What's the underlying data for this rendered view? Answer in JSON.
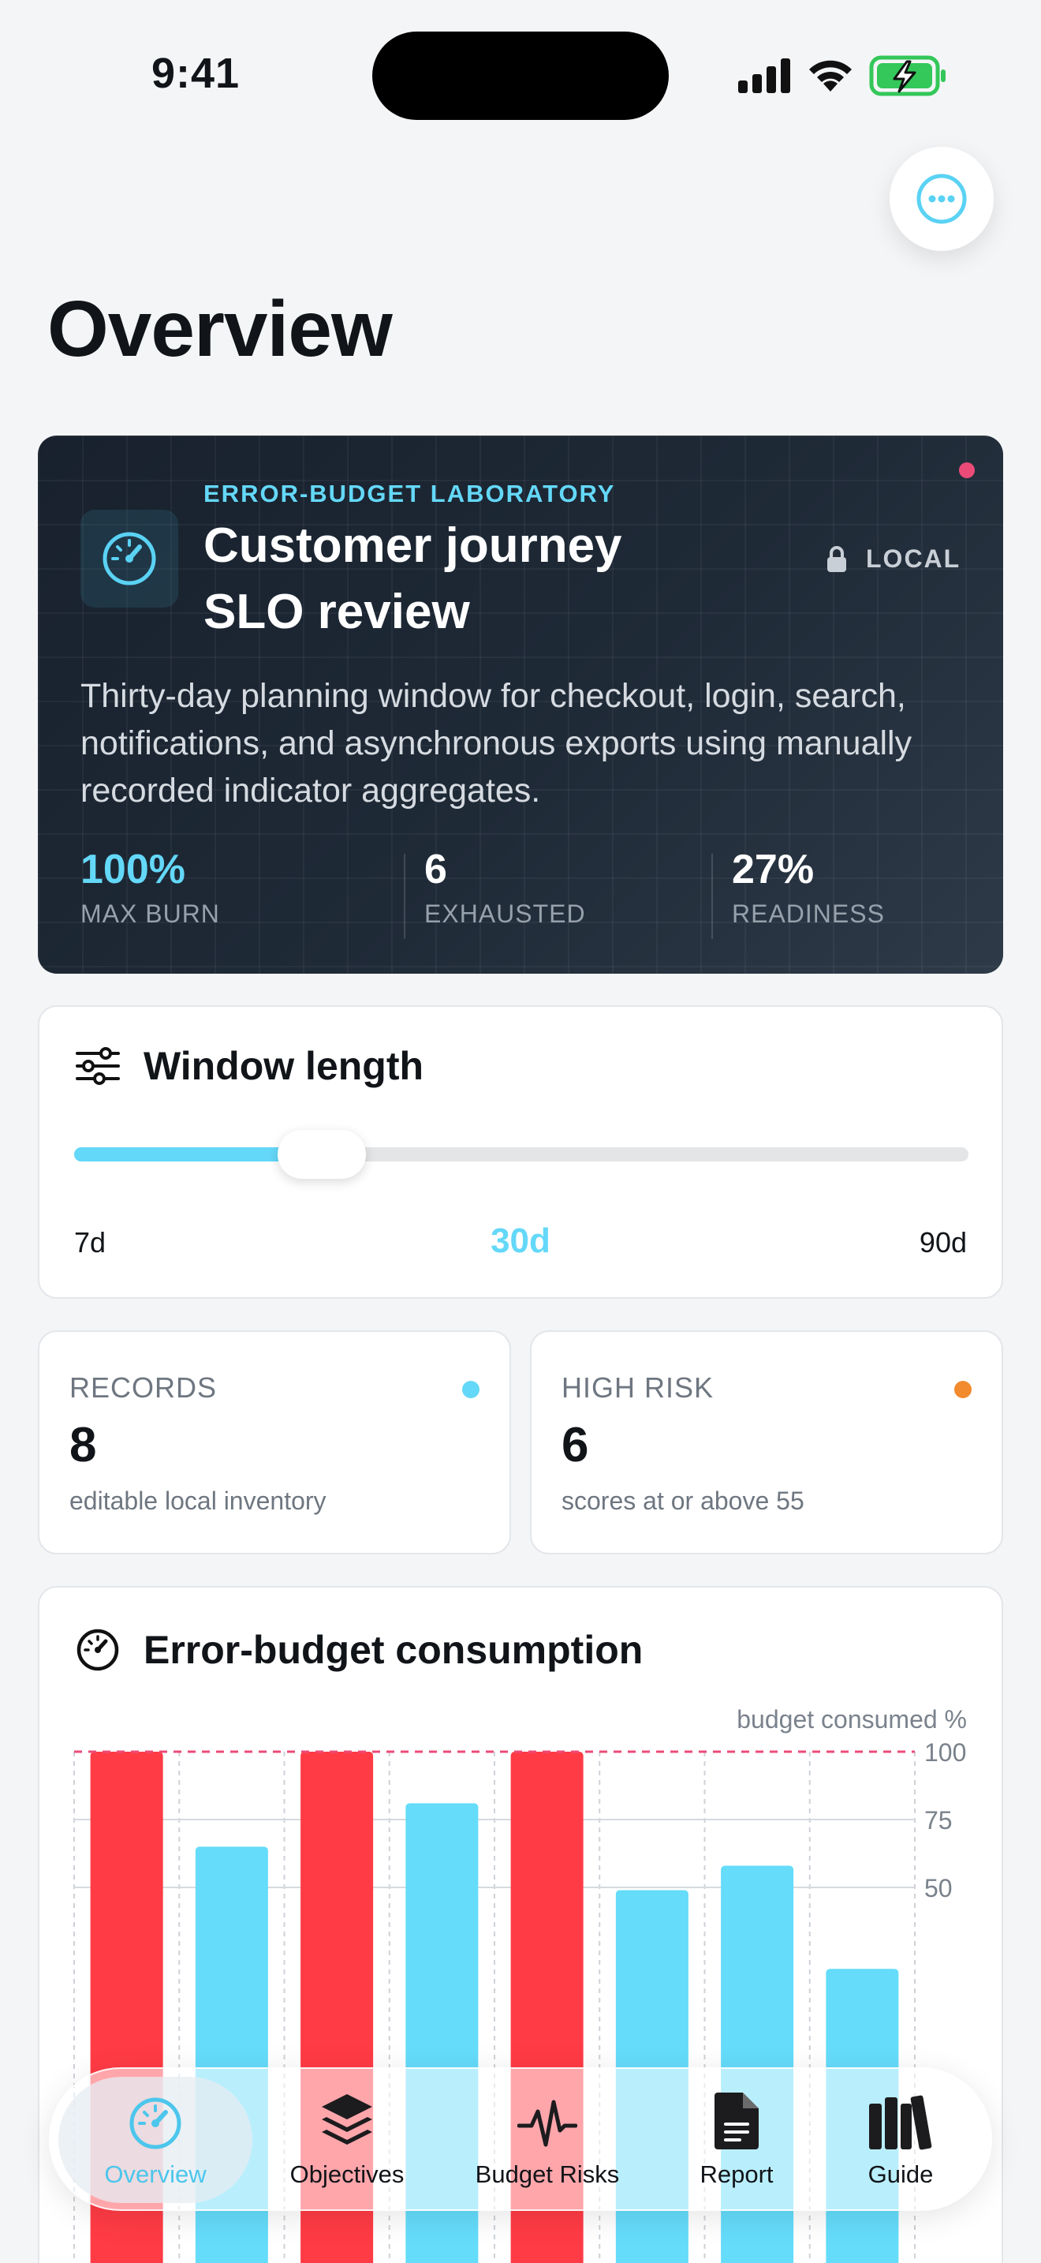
{
  "status_bar": {
    "time": "9:41"
  },
  "header": {
    "title": "Overview"
  },
  "hero": {
    "eyebrow": "ERROR-BUDGET LABORATORY",
    "title": "Customer journey SLO review",
    "badge": "LOCAL",
    "description": "Thirty-day planning window for checkout, login, search, notifications, and asynchronous exports using manually recorded indicator aggregates.",
    "stats": [
      {
        "value": "100%",
        "label": "MAX BURN"
      },
      {
        "value": "6",
        "label": "EXHAUSTED"
      },
      {
        "value": "27%",
        "label": "READINESS"
      }
    ]
  },
  "window_length": {
    "title": "Window length",
    "min_label": "7d",
    "max_label": "90d",
    "value_label": "30d",
    "min": 7,
    "max": 90,
    "value": 30
  },
  "metrics": [
    {
      "label": "RECORDS",
      "value": "8",
      "sub": "editable local inventory",
      "color": "#64d8f8"
    },
    {
      "label": "HIGH RISK",
      "value": "6",
      "sub": "scores at or above 55",
      "color": "#f28a2e"
    }
  ],
  "chart_card": {
    "title": "Error-budget consumption",
    "chart_data": {
      "type": "bar",
      "ylabel": "budget consumed %",
      "yticks": [
        50,
        75,
        100
      ],
      "ylim": [
        0,
        100
      ],
      "threshold": 100,
      "values": [
        100,
        65,
        100,
        81,
        100,
        49,
        58,
        20
      ],
      "categories": [],
      "colors": {
        "over": "#ff3b45",
        "under": "#64dcfa",
        "threshold": "#ec4b78"
      }
    }
  },
  "tabbar": {
    "items": [
      {
        "label": "Overview",
        "icon": "gauge-icon",
        "active": true
      },
      {
        "label": "Objectives",
        "icon": "layers-icon",
        "active": false
      },
      {
        "label": "Budget Risks",
        "icon": "pulse-icon",
        "active": false
      },
      {
        "label": "Report",
        "icon": "document-icon",
        "active": false
      },
      {
        "label": "Guide",
        "icon": "books-icon",
        "active": false
      }
    ]
  },
  "colors": {
    "accent": "#64d8f8",
    "hero_bg": "#1b2430"
  }
}
